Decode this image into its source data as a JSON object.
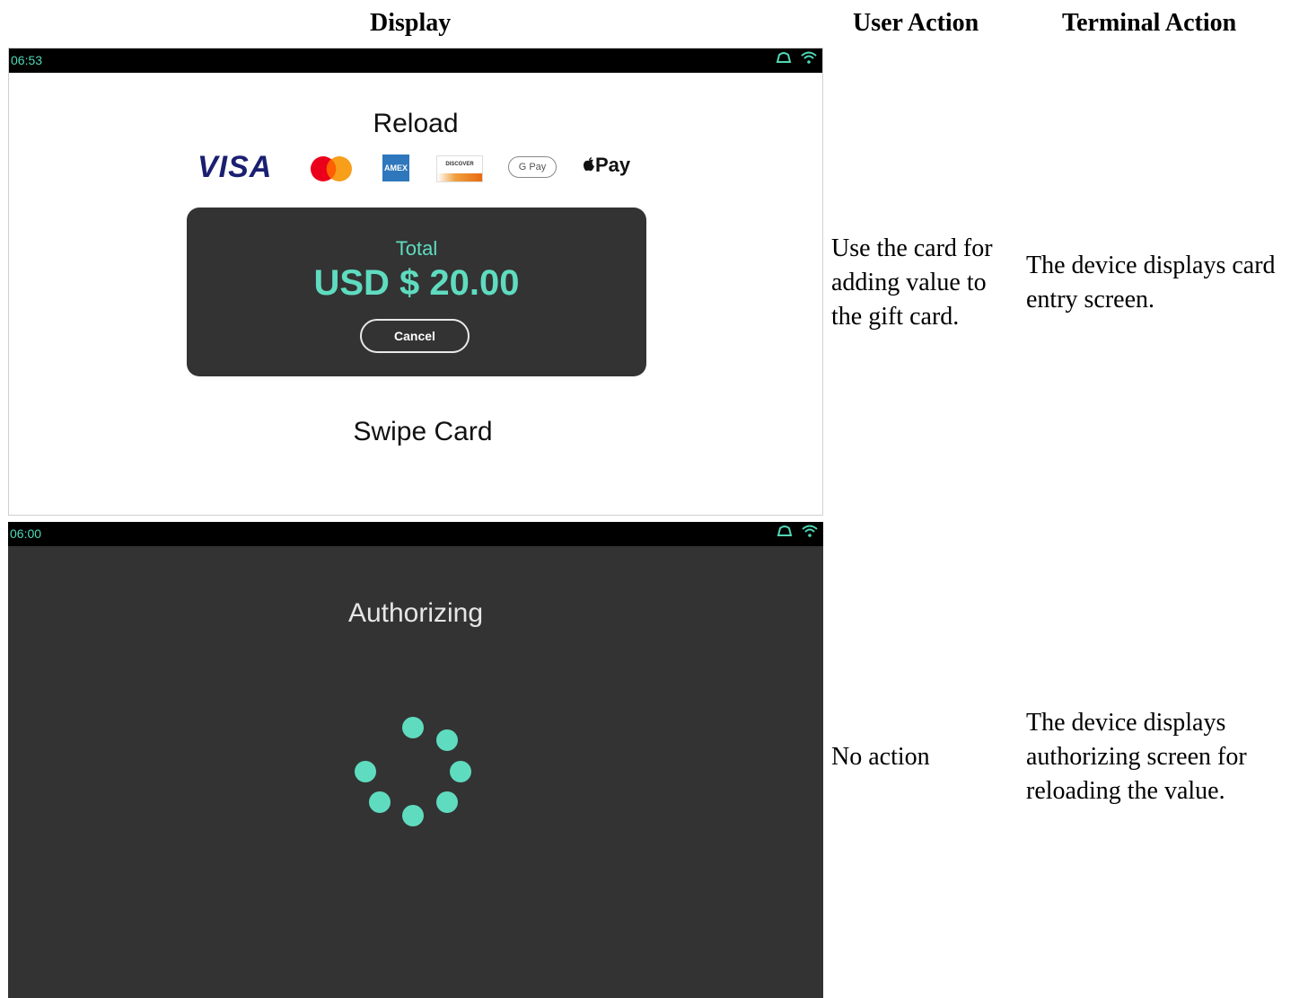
{
  "headers": {
    "display": "Display",
    "user_action": "User Action",
    "terminal_action": "Terminal Action"
  },
  "rows": [
    {
      "screen": {
        "status_time": "06:53",
        "title": "Reload",
        "logos": [
          "VISA",
          "mastercard",
          "AMEX",
          "DISCOVER",
          "G Pay",
          "Pay"
        ],
        "total_label": "Total",
        "total_amount": "USD $ 20.00",
        "cancel_label": "Cancel",
        "prompt": "Swipe Card"
      },
      "user_action": "Use the card for adding value to the gift card.",
      "terminal_action": "The device displays card entry screen."
    },
    {
      "screen": {
        "status_time": "06:00",
        "title": "Authorizing"
      },
      "user_action": "No action",
      "terminal_action": "The device displays authorizing screen for reloading the value."
    }
  ],
  "colors": {
    "accent": "#5fdcbf",
    "dark_panel": "#333333",
    "visa_blue": "#1a1f71"
  }
}
